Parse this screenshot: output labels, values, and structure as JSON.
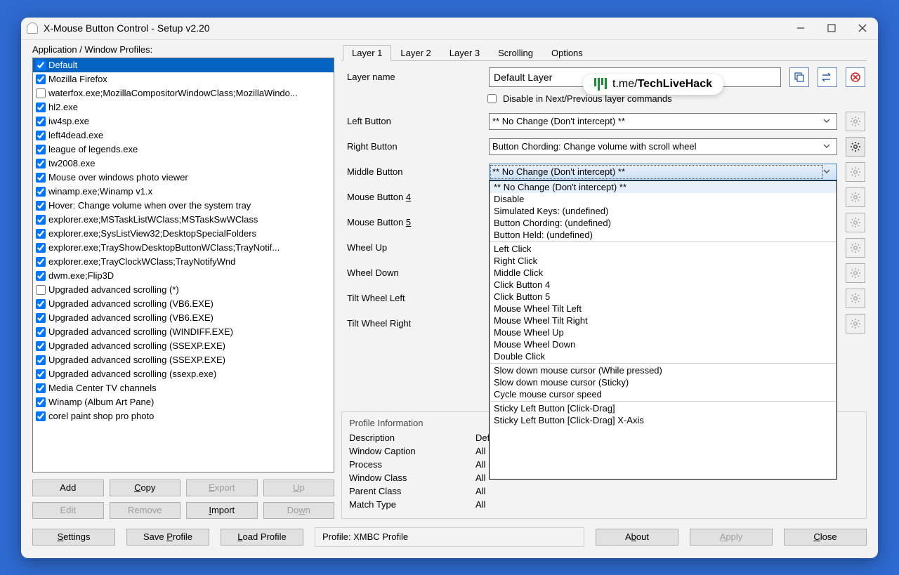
{
  "window": {
    "title": "X-Mouse Button Control - Setup v2.20"
  },
  "overlay_badge": {
    "text_plain": "t.me/",
    "text_bold": "TechLiveHack"
  },
  "left": {
    "label": "Application / Window Profiles:",
    "profiles": [
      {
        "label": "Default",
        "checked": true,
        "selected": true
      },
      {
        "label": "Mozilla Firefox",
        "checked": true
      },
      {
        "label": "waterfox.exe;MozillaCompositorWindowClass;MozillaWindo...",
        "checked": false
      },
      {
        "label": "hl2.exe",
        "checked": true
      },
      {
        "label": "iw4sp.exe",
        "checked": true
      },
      {
        "label": "left4dead.exe",
        "checked": true
      },
      {
        "label": "league of legends.exe",
        "checked": true
      },
      {
        "label": "tw2008.exe",
        "checked": true
      },
      {
        "label": "Mouse over windows photo viewer",
        "checked": true
      },
      {
        "label": "winamp.exe;Winamp v1.x",
        "checked": true
      },
      {
        "label": "Hover: Change volume when over the system tray",
        "checked": true
      },
      {
        "label": "explorer.exe;MSTaskListWClass;MSTaskSwWClass",
        "checked": true
      },
      {
        "label": "explorer.exe;SysListView32;DesktopSpecialFolders",
        "checked": true
      },
      {
        "label": "explorer.exe;TrayShowDesktopButtonWClass;TrayNotif...",
        "checked": true
      },
      {
        "label": "explorer.exe;TrayClockWClass;TrayNotifyWnd",
        "checked": true
      },
      {
        "label": "dwm.exe;Flip3D",
        "checked": true
      },
      {
        "label": "Upgraded advanced scrolling (*)",
        "checked": false
      },
      {
        "label": "Upgraded advanced scrolling (VB6.EXE)",
        "checked": true
      },
      {
        "label": "Upgraded advanced scrolling (VB6.EXE)",
        "checked": true
      },
      {
        "label": "Upgraded advanced scrolling (WINDIFF.EXE)",
        "checked": true
      },
      {
        "label": "Upgraded advanced scrolling (SSEXP.EXE)",
        "checked": true
      },
      {
        "label": "Upgraded advanced scrolling (SSEXP.EXE)",
        "checked": true
      },
      {
        "label": "Upgraded advanced scrolling (ssexp.exe)",
        "checked": true
      },
      {
        "label": "Media Center TV channels",
        "checked": true
      },
      {
        "label": "Winamp (Album Art Pane)",
        "checked": true
      },
      {
        "label": "corel paint shop pro photo",
        "checked": true
      }
    ],
    "btn_add": "Add",
    "btn_copy": "Copy",
    "btn_export": "Export",
    "btn_up": "Up",
    "btn_edit": "Edit",
    "btn_remove": "Remove",
    "btn_import": "Import",
    "btn_down": "Down"
  },
  "tabs": [
    "Layer 1",
    "Layer 2",
    "Layer 3",
    "Scrolling",
    "Options"
  ],
  "layer": {
    "name_label": "Layer name",
    "name_value": "Default Layer",
    "disable_checkbox": "Disable in Next/Previous layer commands",
    "rows": [
      {
        "label": "Left Button",
        "value": "** No Change (Don't intercept) **",
        "gear": false
      },
      {
        "label": "Right Button",
        "value": "Button Chording: Change volume with scroll wheel",
        "gear": true
      },
      {
        "label": "Middle Button",
        "value": "** No Change (Don't intercept) **",
        "open": true,
        "gear": false
      },
      {
        "label": "Mouse Button 4",
        "value": "",
        "gear": false
      },
      {
        "label": "Mouse Button 5",
        "value": "",
        "gear": false
      },
      {
        "label": "Wheel Up",
        "value": "",
        "gear": false
      },
      {
        "label": "Wheel Down",
        "value": "",
        "gear": false
      },
      {
        "label": "Tilt Wheel Left",
        "value": "",
        "gear": false
      },
      {
        "label": "Tilt Wheel Right",
        "value": "",
        "gear": false
      }
    ]
  },
  "dropdown_options": [
    {
      "label": "** No Change (Don't intercept) **",
      "highlight": true
    },
    {
      "label": "Disable"
    },
    {
      "label": "Simulated Keys: (undefined)"
    },
    {
      "label": "Button Chording: (undefined)"
    },
    {
      "label": "Button Held: (undefined)"
    },
    {
      "sep": true
    },
    {
      "label": "Left Click"
    },
    {
      "label": "Right Click"
    },
    {
      "label": "Middle Click"
    },
    {
      "label": "Click Button 4"
    },
    {
      "label": "Click Button 5"
    },
    {
      "label": "Mouse Wheel Tilt Left"
    },
    {
      "label": "Mouse Wheel Tilt Right"
    },
    {
      "label": "Mouse Wheel Up"
    },
    {
      "label": "Mouse Wheel Down"
    },
    {
      "label": "Double Click"
    },
    {
      "sep": true
    },
    {
      "label": "Slow down mouse cursor (While pressed)"
    },
    {
      "label": "Slow down mouse cursor (Sticky)"
    },
    {
      "label": "Cycle mouse cursor speed"
    },
    {
      "sep": true
    },
    {
      "label": "Sticky Left Button [Click-Drag]"
    },
    {
      "label": "Sticky Left Button [Click-Drag] X-Axis"
    }
  ],
  "profile_info": {
    "heading": "Profile Information",
    "rows": [
      {
        "label": "Description",
        "value": "Defa"
      },
      {
        "label": "Window Caption",
        "value": "All"
      },
      {
        "label": "Process",
        "value": "All"
      },
      {
        "label": "Window Class",
        "value": "All"
      },
      {
        "label": "Parent Class",
        "value": "All"
      },
      {
        "label": "Match Type",
        "value": "All"
      }
    ]
  },
  "footer": {
    "settings": "Settings",
    "save": "Save Profile",
    "load": "Load Profile",
    "profile_label": "Profile:  XMBC Profile",
    "about": "About",
    "apply": "Apply",
    "close": "Close"
  }
}
